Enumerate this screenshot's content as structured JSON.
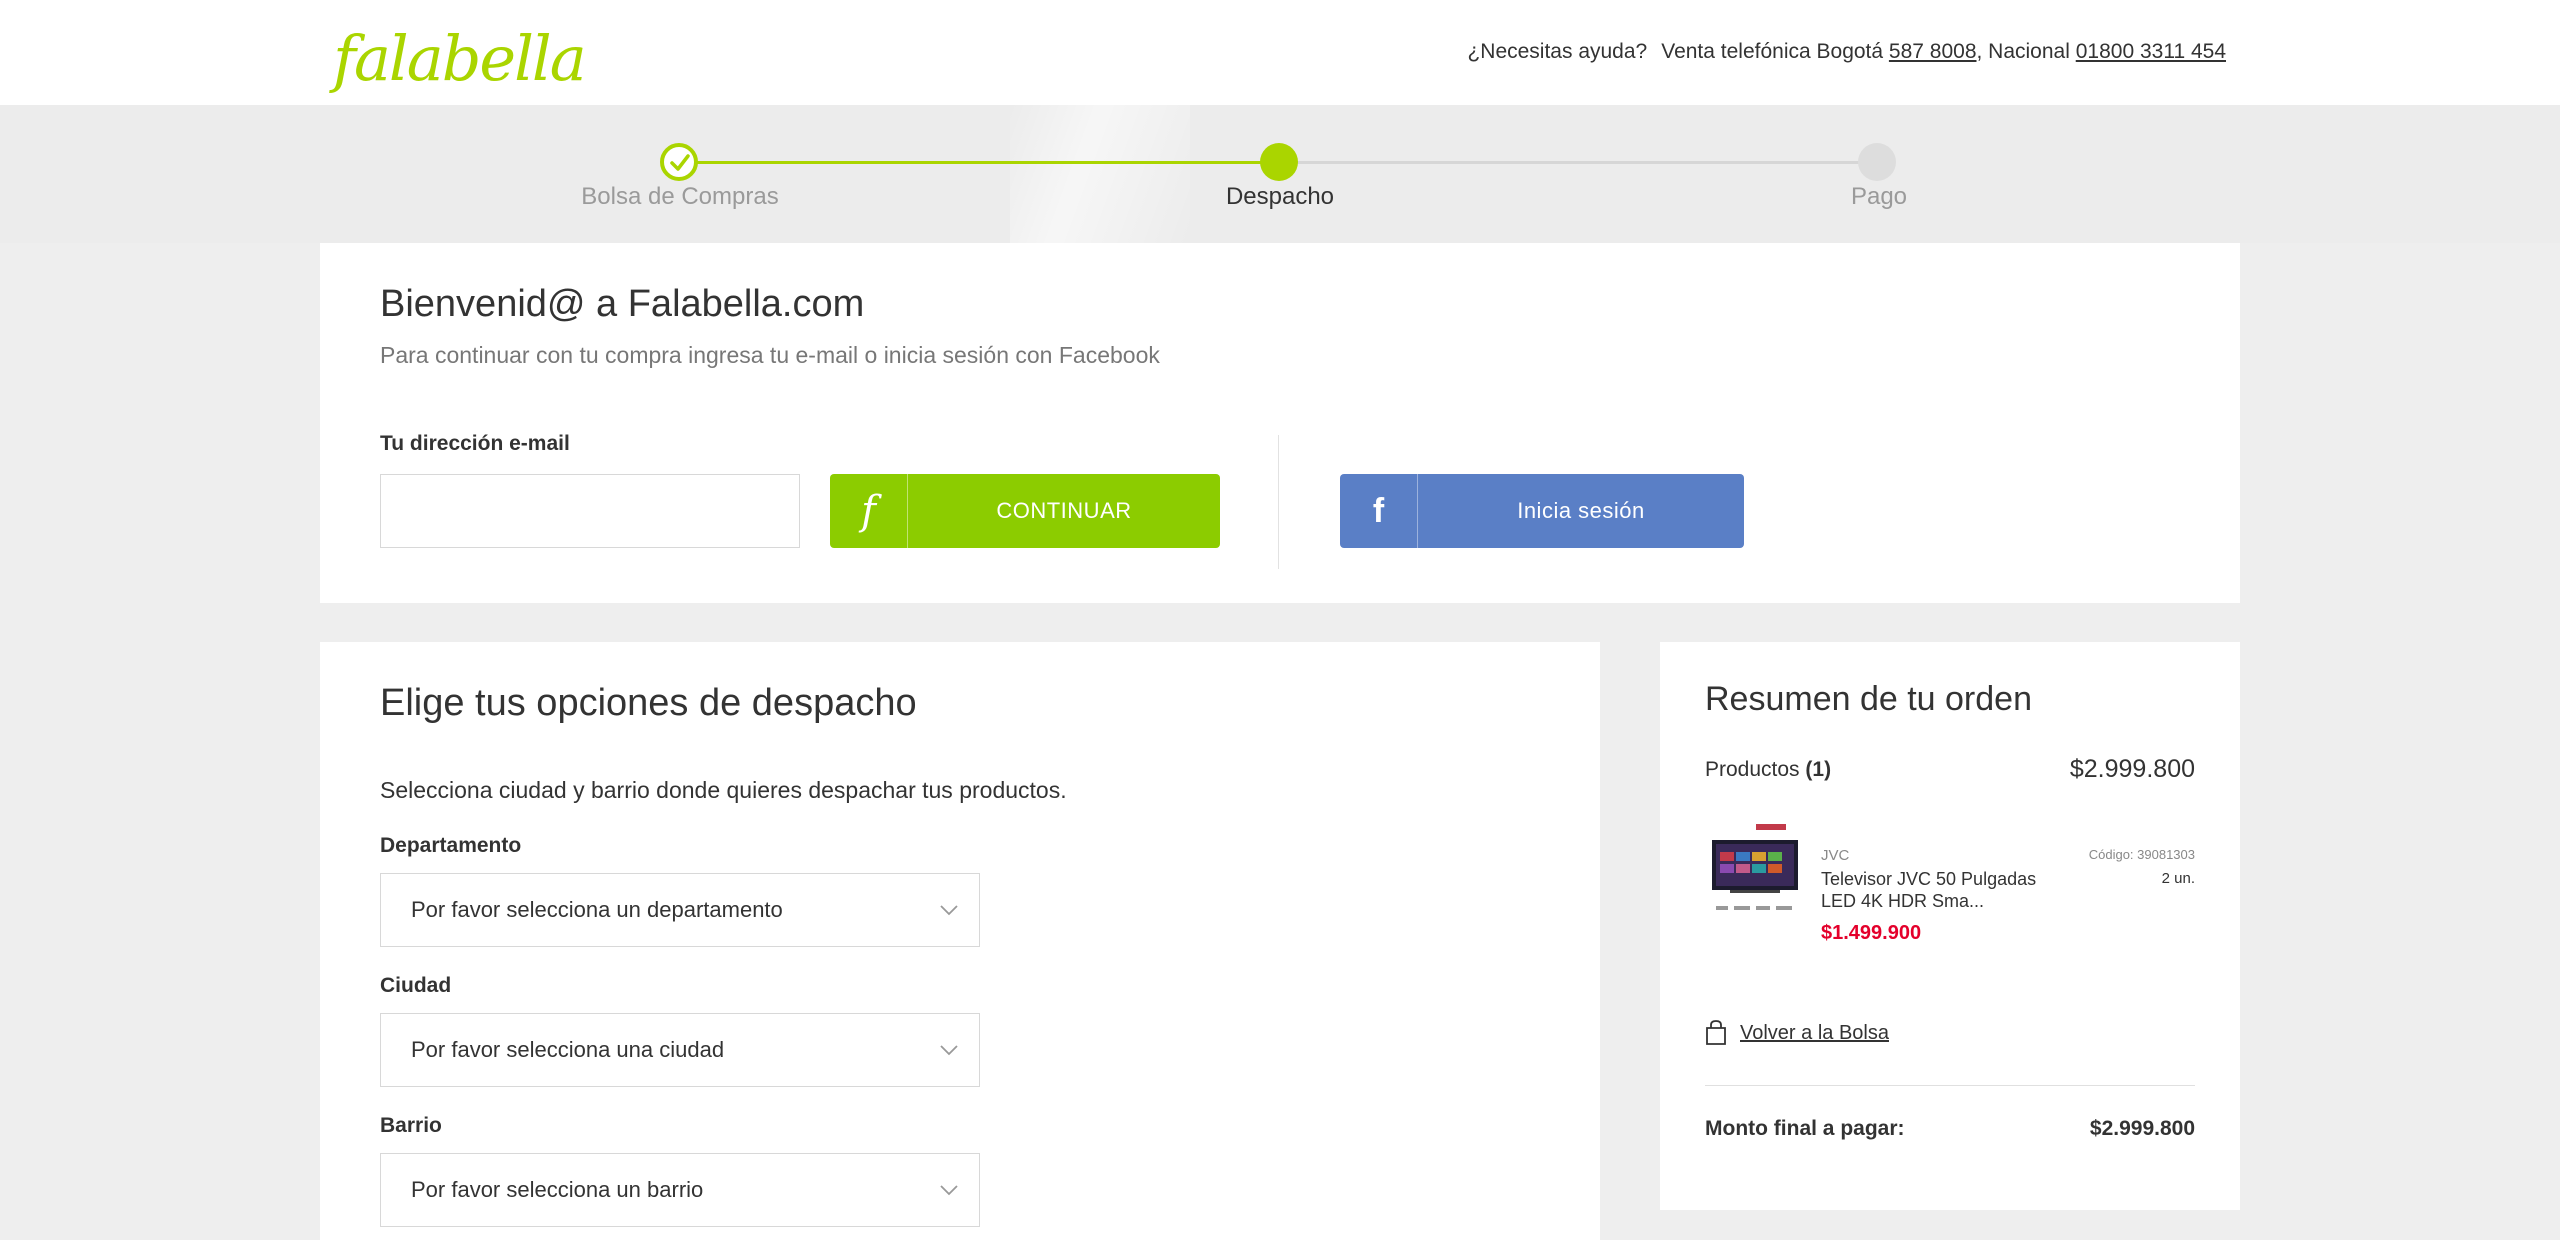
{
  "header": {
    "logo_text": "falabella",
    "help_question": "¿Necesitas ayuda?",
    "phone_prefix": "Venta telefónica Bogotá",
    "phone_bogota": "587 8008",
    "phone_separator": ", Nacional",
    "phone_national": "01800 3311 454"
  },
  "stepper": {
    "steps": [
      {
        "label": "Bolsa de Compras",
        "state": "done"
      },
      {
        "label": "Despacho",
        "state": "active"
      },
      {
        "label": "Pago",
        "state": "pending"
      }
    ],
    "accent_color": "#aad500"
  },
  "welcome": {
    "title": "Bienvenid@ a Falabella.com",
    "subtitle": "Para continuar con tu compra ingresa tu e-mail o inicia sesión con Facebook",
    "email_label": "Tu dirección e-mail",
    "email_value": "",
    "continue_icon": "f",
    "continue_label": "CONTINUAR",
    "facebook_icon": "f",
    "facebook_label": "Inicia sesión",
    "continue_color": "#8ccc00",
    "facebook_color": "#5a7fc6"
  },
  "shipping": {
    "title": "Elige tus opciones de despacho",
    "description": "Selecciona ciudad y barrio donde quieres despachar tus productos.",
    "fields": [
      {
        "label": "Departamento",
        "selected": "Por favor selecciona un departamento"
      },
      {
        "label": "Ciudad",
        "selected": "Por favor selecciona una ciudad"
      },
      {
        "label": "Barrio",
        "selected": "Por favor selecciona un barrio"
      }
    ]
  },
  "summary": {
    "title": "Resumen de tu orden",
    "products_label": "Productos",
    "products_count": "(1)",
    "products_total": "$2.999.800",
    "item": {
      "brand": "JVC",
      "name": "Televisor JVC 50 Pulgadas LED 4K HDR Sma...",
      "price": "$1.499.900",
      "code": "Código: 39081303",
      "quantity": "2 un."
    },
    "back_link": "Volver a la Bolsa",
    "final_label": "Monto final a pagar:",
    "final_value": "$2.999.800",
    "price_color": "#e4002b"
  }
}
